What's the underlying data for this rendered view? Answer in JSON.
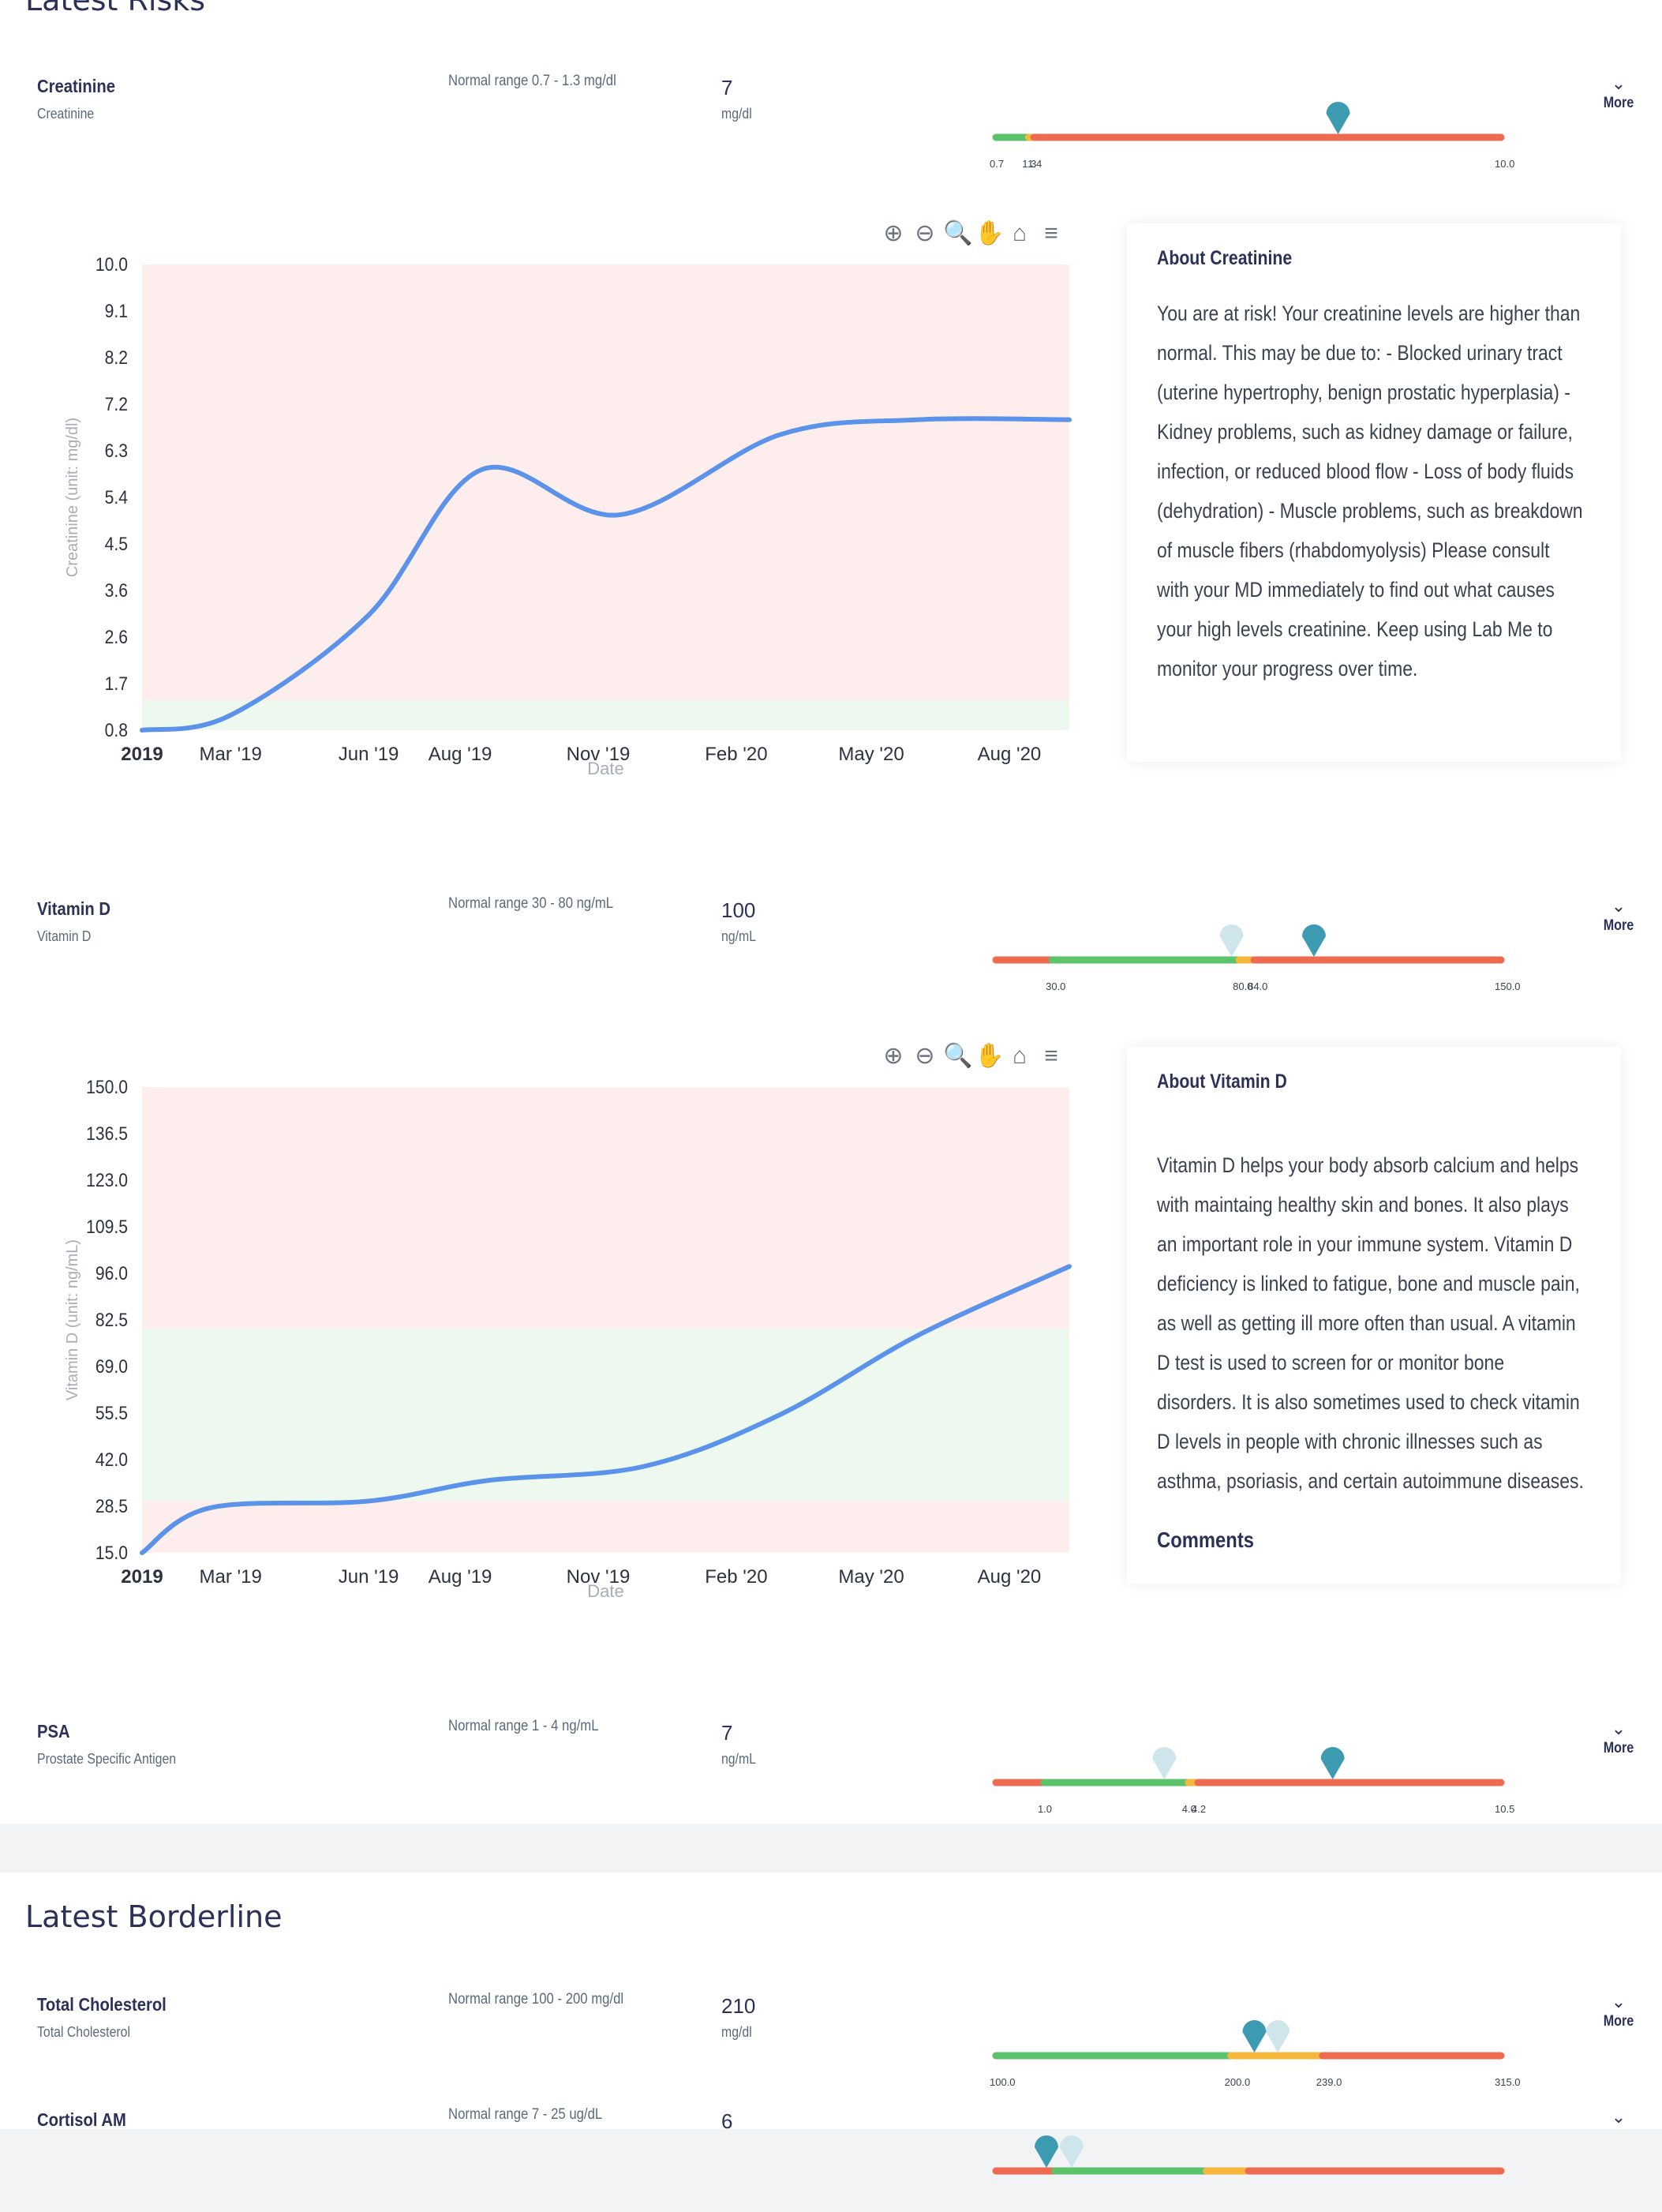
{
  "sections": {
    "risks_title": "Latest Risks",
    "borderline_title": "Latest Borderline"
  },
  "more_label": "More",
  "colors": {
    "normal": "#5cc36c",
    "borderline": "#f5b83d",
    "risk": "#ee6b52",
    "marker_current": "#3d9bb1",
    "marker_previous": "#cfe5ec",
    "line": "#5b93ea",
    "risk_band": "#fdeeed",
    "normal_band": "#edf8ef"
  },
  "tests": [
    {
      "name": "Creatinine",
      "subtitle": "Creatinine",
      "range_text": "Normal range 0.7 - 1.3 mg/dl",
      "value": "7",
      "unit": "mg/dl",
      "gauge": {
        "min": 0.7,
        "max": 10.0,
        "normal_low": 0.7,
        "normal_high": 1.3,
        "border_high": 1.4,
        "current": 7,
        "previous": null,
        "ticks": [
          "0.7",
          "1.3",
          "1.4",
          "10.0"
        ],
        "low_risk": false
      },
      "about_title": "About Creatinine",
      "about_text": "You are at risk! Your creatinine levels are higher than normal. This may be due to: - Blocked urinary tract (uterine hypertrophy, benign prostatic hyperplasia) - Kidney problems, such as kidney damage or failure, infection, or reduced blood flow - Loss of body fluids (dehydration) - Muscle problems, such as breakdown of muscle fibers (rhabdomyolysis) Please consult with your MD immediately to find out what causes your high levels creatinine. Keep using Lab Me to monitor your progress over time.",
      "comments_label": ""
    },
    {
      "name": "Vitamin D",
      "subtitle": "Vitamin D",
      "range_text": "Normal range 30 - 80 ng/mL",
      "value": "100",
      "unit": "ng/mL",
      "gauge": {
        "min": 15,
        "max": 150,
        "normal_low": 30,
        "normal_high": 80,
        "border_high": 84,
        "current": 100,
        "previous": 78,
        "ticks": [
          "30.0",
          "80.0",
          "84.0",
          "150.0"
        ],
        "low_risk": true
      },
      "about_title": "About Vitamin D",
      "about_text": "Vitamin D helps your body absorb calcium and helps with maintaing healthy skin and bones. It also plays an important role in your immune system. Vitamin D deficiency is linked to fatigue, bone and muscle pain, as well as getting ill more often than usual. A vitamin D test is used to screen for or monitor bone disorders. It is also sometimes used to check vitamin D levels in people with chronic illnesses such as asthma, psoriasis, and certain autoimmune diseases.",
      "comments_label": "Comments"
    },
    {
      "name": "PSA",
      "subtitle": "Prostate Specific Antigen",
      "range_text": "Normal range 1 - 4 ng/mL",
      "value": "7",
      "unit": "ng/mL",
      "gauge": {
        "min": 0,
        "max": 10.5,
        "normal_low": 1,
        "normal_high": 4,
        "border_high": 4.2,
        "current": 7,
        "previous": 3.5,
        "ticks": [
          "1.0",
          "4.0",
          "4.2",
          "10.5"
        ],
        "low_risk": true
      }
    }
  ],
  "borderline": [
    {
      "name": "Total Cholesterol",
      "subtitle": "Total Cholesterol",
      "range_text": "Normal range 100 - 200 mg/dl",
      "value": "210",
      "unit": "mg/dl",
      "gauge": {
        "min": 100,
        "max": 315,
        "normal_low": 100,
        "normal_high": 200,
        "border_high": 239,
        "current": 210,
        "previous": 220,
        "ticks": [
          "100.0",
          "200.0",
          "239.0",
          "315.0"
        ],
        "low_risk": false
      }
    },
    {
      "name": "Cortisol AM",
      "subtitle": "",
      "range_text": "Normal range 7 - 25 ug/dL",
      "value": "6",
      "unit": "",
      "gauge": {
        "min": 0,
        "max": 60,
        "normal_low": 7,
        "normal_high": 25,
        "border_high": 30,
        "current": 6,
        "previous": 9,
        "ticks": [],
        "low_risk": true
      }
    }
  ],
  "chart_data": [
    {
      "type": "line",
      "title": "",
      "xlabel": "Date",
      "ylabel": "Creatinine (unit: mg/dl)",
      "yticks": [
        "10.0",
        "9.1",
        "8.2",
        "7.2",
        "6.3",
        "5.4",
        "4.5",
        "3.6",
        "2.6",
        "1.7",
        "0.8"
      ],
      "ylim": [
        0.7,
        10.0
      ],
      "xlim": [
        "2019-01-01",
        "2020-09-10"
      ],
      "xticks": [
        {
          "date": "2019-01-01",
          "label": "2019"
        },
        {
          "date": "2019-03-01",
          "label": "Mar '19"
        },
        {
          "date": "2019-06-01",
          "label": "Jun '19"
        },
        {
          "date": "2019-08-01",
          "label": "Aug '19"
        },
        {
          "date": "2019-11-01",
          "label": "Nov '19"
        },
        {
          "date": "2020-02-01",
          "label": "Feb '20"
        },
        {
          "date": "2020-05-01",
          "label": "May '20"
        },
        {
          "date": "2020-08-01",
          "label": "Aug '20"
        }
      ],
      "bands": [
        {
          "from": 0.7,
          "to": 1.3,
          "kind": "normal"
        },
        {
          "from": 1.3,
          "to": 10.0,
          "kind": "risk"
        }
      ],
      "series": [
        {
          "x": [
            "2019-01-01",
            "2019-03-01",
            "2019-06-01",
            "2019-08-15",
            "2019-11-15",
            "2020-03-01",
            "2020-06-01",
            "2020-09-10"
          ],
          "y": [
            0.7,
            1.0,
            3.0,
            5.9,
            5.0,
            6.6,
            6.9,
            6.9
          ]
        }
      ],
      "toolbar": [
        "⊕",
        "⊖",
        "🔍",
        "✋",
        "⌂",
        "≡"
      ]
    },
    {
      "type": "line",
      "title": "",
      "xlabel": "Date",
      "ylabel": "Vitamin D (unit: ng/mL)",
      "yticks": [
        "150.0",
        "136.5",
        "123.0",
        "109.5",
        "96.0",
        "82.5",
        "69.0",
        "55.5",
        "42.0",
        "28.5",
        "15.0"
      ],
      "ylim": [
        15,
        150
      ],
      "xlim": [
        "2019-01-01",
        "2020-09-10"
      ],
      "xticks": [
        {
          "date": "2019-01-01",
          "label": "2019"
        },
        {
          "date": "2019-03-01",
          "label": "Mar '19"
        },
        {
          "date": "2019-06-01",
          "label": "Jun '19"
        },
        {
          "date": "2019-08-01",
          "label": "Aug '19"
        },
        {
          "date": "2019-11-01",
          "label": "Nov '19"
        },
        {
          "date": "2020-02-01",
          "label": "Feb '20"
        },
        {
          "date": "2020-05-01",
          "label": "May '20"
        },
        {
          "date": "2020-08-01",
          "label": "Aug '20"
        }
      ],
      "bands": [
        {
          "from": 15,
          "to": 30,
          "kind": "risk"
        },
        {
          "from": 30,
          "to": 80,
          "kind": "normal"
        },
        {
          "from": 80,
          "to": 150,
          "kind": "risk"
        }
      ],
      "series": [
        {
          "x": [
            "2019-01-01",
            "2019-02-15",
            "2019-06-01",
            "2019-08-20",
            "2019-12-01",
            "2020-03-01",
            "2020-06-01",
            "2020-09-10"
          ],
          "y": [
            15,
            28,
            30,
            36,
            40,
            55,
            78,
            98
          ]
        }
      ],
      "toolbar": [
        "⊕",
        "⊖",
        "🔍",
        "✋",
        "⌂",
        "≡"
      ]
    }
  ]
}
